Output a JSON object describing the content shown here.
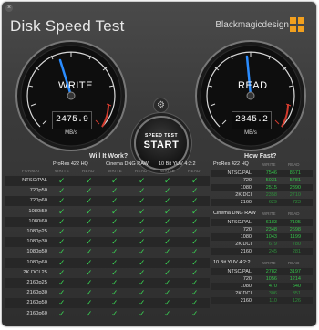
{
  "window": {
    "close_glyph": "×",
    "title": "Disk Speed Test",
    "brand": "Blackmagicdesign",
    "brand_color": "#f2a01e"
  },
  "gauges": {
    "write": {
      "label": "WRITE",
      "value": "2475.9",
      "unit": "MB/s"
    },
    "read": {
      "label": "READ",
      "value": "2845.2",
      "unit": "MB/s"
    }
  },
  "settings_icon": "gear-icon",
  "start_button": {
    "small": "SPEED TEST",
    "big": "START"
  },
  "will_it_work": {
    "title": "Will It Work?",
    "codecs": [
      "ProRes 422 HQ",
      "Cinema DNG RAW",
      "10 Bit YUV 4:2:2"
    ],
    "format_header": "FORMAT",
    "write_header": "WRITE",
    "read_header": "READ",
    "formats": [
      "NTSC/PAL",
      "720p50",
      "720p60",
      "1080i50",
      "1080i60",
      "1080p25",
      "1080p30",
      "1080p50",
      "1080p60",
      "2K DCI 25",
      "2160p25",
      "2160p30",
      "2160p50",
      "2160p60"
    ],
    "check_glyph": "✓",
    "check_color": "#39d353"
  },
  "how_fast": {
    "title": "How Fast?",
    "write_header": "WRITE",
    "read_header": "READ",
    "groups": [
      {
        "name": "ProRes 422 HQ",
        "rows": [
          {
            "fmt": "NTSC/PAL",
            "w": "7546",
            "r": "8671"
          },
          {
            "fmt": "720",
            "w": "5031",
            "r": "5781"
          },
          {
            "fmt": "1080",
            "w": "2515",
            "r": "2890"
          },
          {
            "fmt": "2K DCI",
            "w": "2358",
            "r": "2710"
          },
          {
            "fmt": "2160",
            "w": "629",
            "r": "723"
          }
        ]
      },
      {
        "name": "Cinema DNG RAW",
        "rows": [
          {
            "fmt": "NTSC/PAL",
            "w": "6183",
            "r": "7105"
          },
          {
            "fmt": "720",
            "w": "2348",
            "r": "2698"
          },
          {
            "fmt": "1080",
            "w": "1043",
            "r": "1199"
          },
          {
            "fmt": "2K DCI",
            "w": "679",
            "r": "780"
          },
          {
            "fmt": "2160",
            "w": "245",
            "r": "281"
          }
        ]
      },
      {
        "name": "10 Bit YUV 4:2:2",
        "rows": [
          {
            "fmt": "NTSC/PAL",
            "w": "2782",
            "r": "3197"
          },
          {
            "fmt": "720",
            "w": "1056",
            "r": "1214"
          },
          {
            "fmt": "1080",
            "w": "470",
            "r": "540"
          },
          {
            "fmt": "2K DCI",
            "w": "306",
            "r": "351"
          },
          {
            "fmt": "2160",
            "w": "110",
            "r": "126"
          }
        ]
      }
    ]
  }
}
